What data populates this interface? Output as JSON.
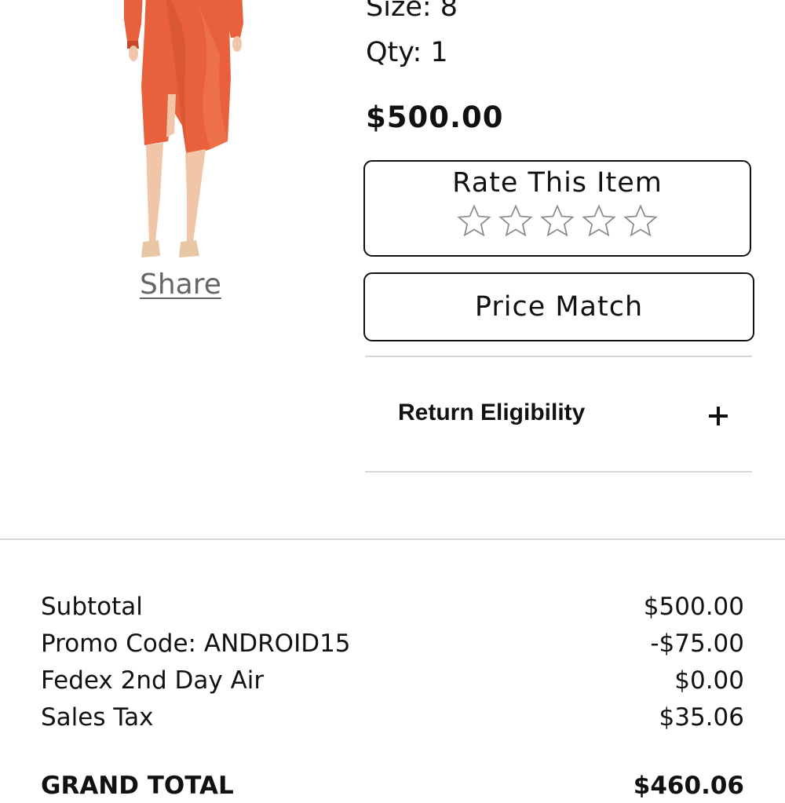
{
  "product": {
    "image_alt": "Orange satin wrap dress",
    "share_label": "Share",
    "size_text": "Size: 8",
    "qty_text": "Qty: 1",
    "price": "$500.00"
  },
  "rating": {
    "title": "Rate This Item",
    "max_stars": 5,
    "value": 0
  },
  "price_match": {
    "label": "Price Match"
  },
  "return_eligibility": {
    "label": "Return Eligibility"
  },
  "summary": {
    "rows": [
      {
        "label": "Subtotal",
        "value": "$500.00"
      },
      {
        "label": "Promo Code: ANDROID15",
        "value": "-$75.00"
      },
      {
        "label": "Fedex 2nd Day Air",
        "value": "$0.00"
      },
      {
        "label": "Sales Tax",
        "value": "$35.06"
      }
    ],
    "grand_total_label": "GRAND TOTAL",
    "grand_total_value": "$460.06"
  },
  "colors": {
    "dress": "#e8613c",
    "border": "#111111",
    "divider": "#d7d7d7",
    "share_text": "#666666"
  }
}
